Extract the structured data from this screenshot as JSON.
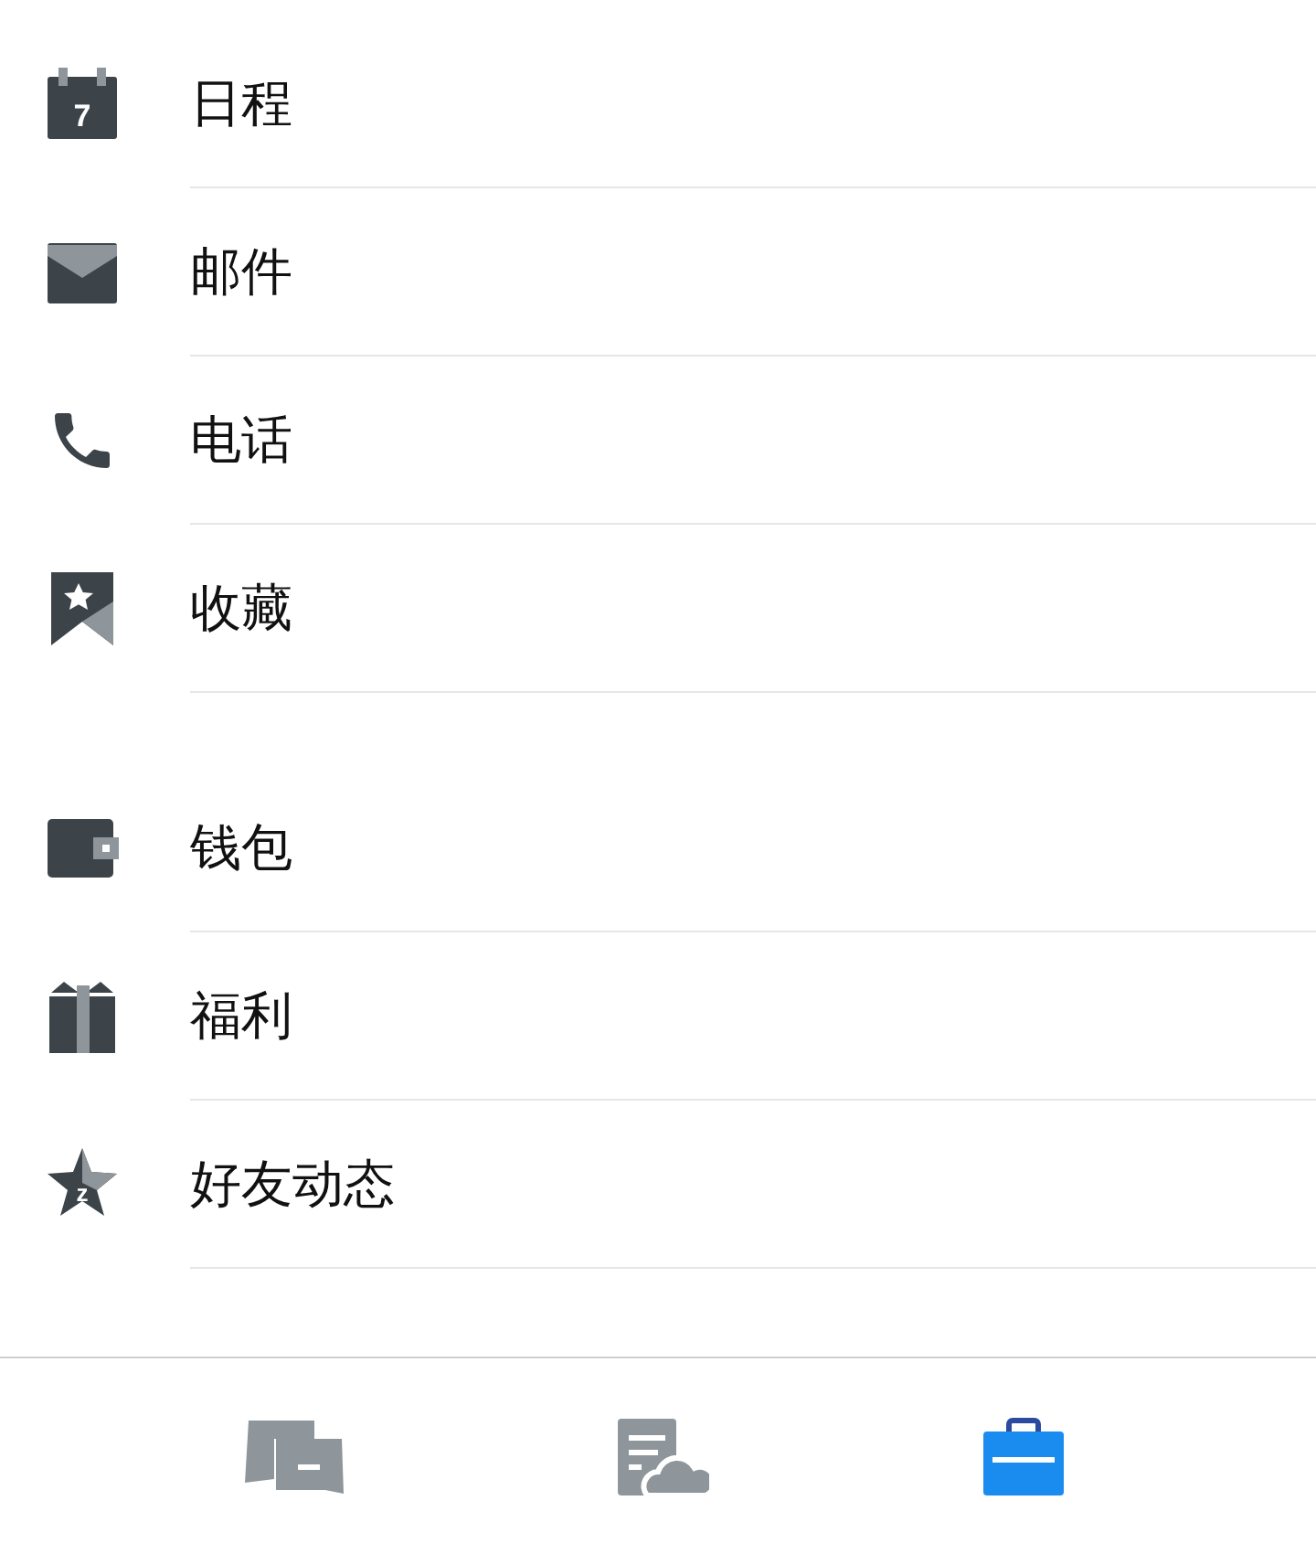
{
  "sections": [
    {
      "items": [
        {
          "kind": "calendar",
          "label": "日程",
          "icon_text": "7"
        },
        {
          "kind": "mail",
          "label": "邮件"
        },
        {
          "kind": "phone",
          "label": "电话"
        },
        {
          "kind": "bookmark",
          "label": "收藏"
        }
      ]
    },
    {
      "items": [
        {
          "kind": "wallet",
          "label": "钱包"
        },
        {
          "kind": "gift",
          "label": "福利"
        },
        {
          "kind": "star",
          "label": "好友动态",
          "icon_text": "z"
        }
      ]
    }
  ],
  "tabs": [
    {
      "kind": "chat",
      "selected": false
    },
    {
      "kind": "cloud-doc",
      "selected": false
    },
    {
      "kind": "briefcase",
      "selected": true
    }
  ]
}
